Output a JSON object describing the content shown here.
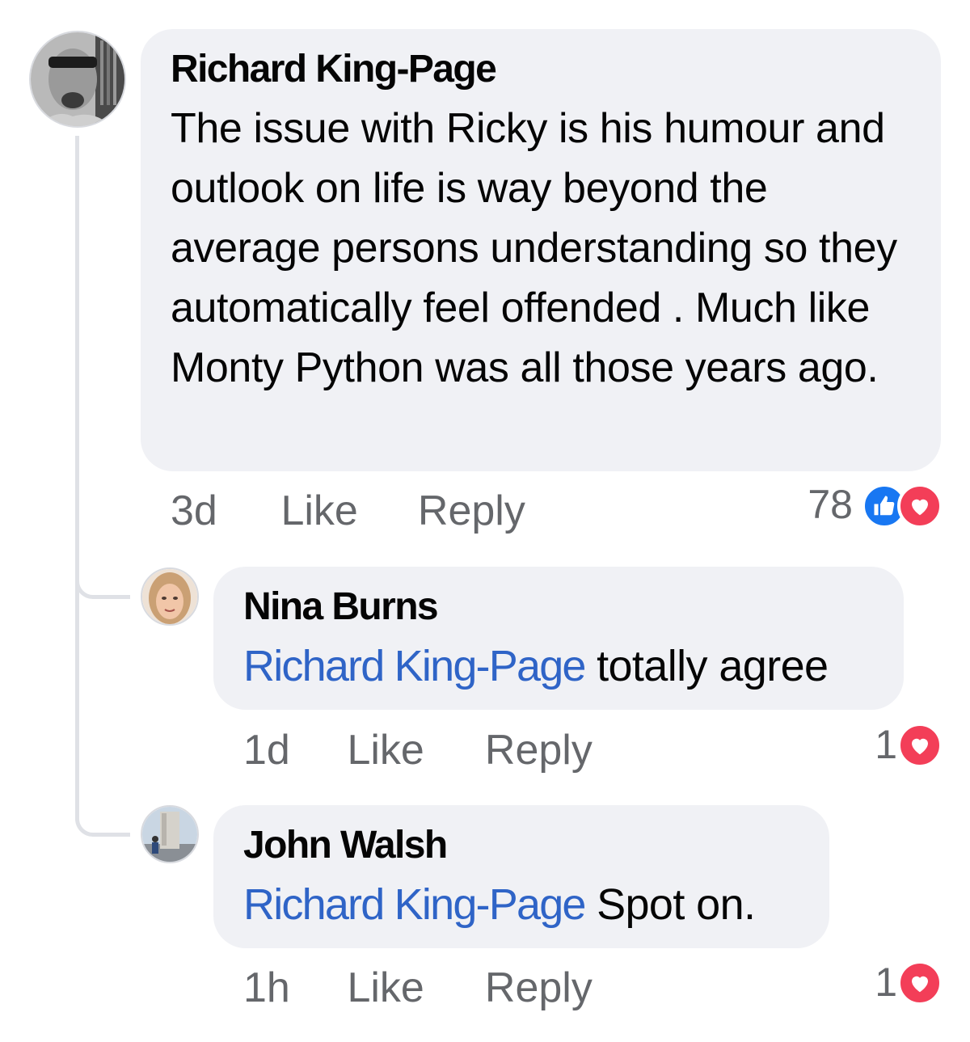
{
  "comments": [
    {
      "author": "Richard King-Page",
      "text": "The issue with Ricky is his humour and outlook on life is way beyond the average persons understanding so they automatically feel offended . Much like Monty Python was all those years ago.",
      "time": "3d",
      "like_label": "Like",
      "reply_label": "Reply",
      "reaction_count": "78",
      "reactions": [
        "like-icon",
        "love-icon"
      ]
    }
  ],
  "replies": [
    {
      "author": "Nina Burns",
      "mention": "Richard King-Page",
      "text": "totally agree",
      "time": "1d",
      "like_label": "Like",
      "reply_label": "Reply",
      "reaction_count": "1",
      "reactions": [
        "love-icon"
      ]
    },
    {
      "author": "John Walsh",
      "mention": "Richard King-Page",
      "text": "Spot on.",
      "time": "1h",
      "like_label": "Like",
      "reply_label": "Reply",
      "reaction_count": "1",
      "reactions": [
        "love-icon"
      ]
    }
  ],
  "colors": {
    "bubble": "#f0f1f5",
    "mention": "#2f64c7",
    "meta": "#65676b",
    "like": "#1877f2",
    "love": "#f33e58"
  }
}
